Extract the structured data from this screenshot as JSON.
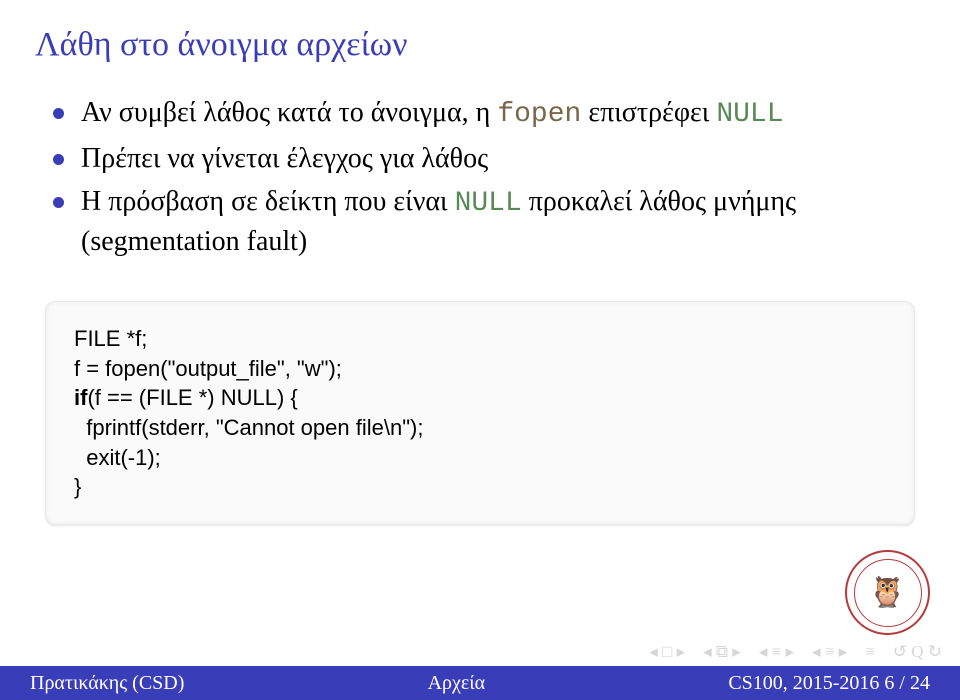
{
  "title": "Λάθη στο άνοιγμα αρχείων",
  "bullets": {
    "b1_pre": "Αν συμβεί λάθος κατά το άνοιγμα, η ",
    "b1_code": "fopen",
    "b1_post": " επιστρέφει ",
    "b1_null": "NULL",
    "b2": "Πρέπει να γίνεται έλεγχος για λάθος",
    "b3_pre": "Η πρόσβαση σε δείκτη που είναι ",
    "b3_null": "NULL",
    "b3_post": " προκαλεί λάθος μνήμης (segmentation fault)"
  },
  "code": {
    "l1": "FILE *f;",
    "l2": "",
    "l3_a": "f = fopen(\"output_file\", \"w\");",
    "l4_if": "if",
    "l4_rest": "(f == (FILE *) NULL) {",
    "l5": "  fprintf(stderr, \"Cannot open file\\n\");",
    "l6": "  exit(-1);",
    "l7": "}"
  },
  "footer": {
    "left": "Πρατικάκης (CSD)",
    "center": "Αρχεία",
    "right": "CS100, 2015-2016    6 / 24"
  },
  "nav": {
    "first": "◂ □ ▸",
    "back": "◂ ⧉ ▸",
    "prev": "◂ ≡ ▸",
    "next": "◂ ≡ ▸",
    "menu": "≡",
    "cycle": "↺ Q ↻"
  }
}
